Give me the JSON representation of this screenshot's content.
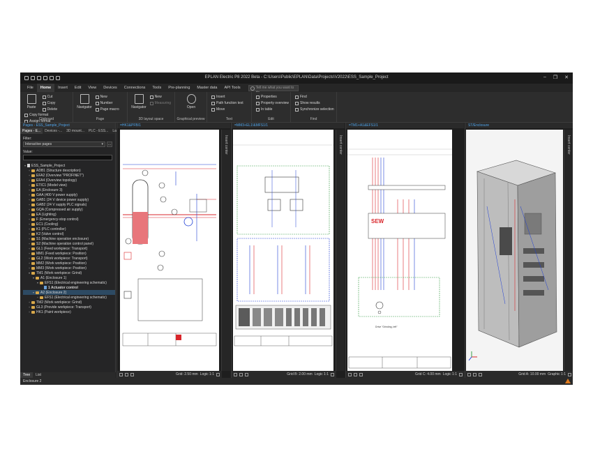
{
  "window": {
    "title": "EPLAN Electric P8 2022 Beta - C:\\Users\\Public\\EPLAN\\Data\\Projects\\V2022\\ESS_Sample_Project"
  },
  "menu": {
    "items": [
      "File",
      "Home",
      "Insert",
      "Edit",
      "View",
      "Devices",
      "Connections",
      "Tools",
      "Pre-planning",
      "Master data",
      "API Tools"
    ],
    "active": "Home",
    "help_placeholder": "Tell me what you want to do"
  },
  "ribbon": {
    "clipboard": {
      "label": "Clipboard",
      "paste": "Paste",
      "cut": "Cut",
      "copy": "Copy",
      "delete": "Delete",
      "copy_format": "Copy format",
      "assign_format": "Assign format"
    },
    "page": {
      "label": "Page",
      "navigator": "Navigator",
      "new": "New",
      "number": "Number",
      "page_macro": "Page macro"
    },
    "layout3d": {
      "label": "3D layout space",
      "navigator": "Navigator",
      "new": "New",
      "measuring": "Measuring"
    },
    "preview": {
      "label": "Graphical preview",
      "open": "Open"
    },
    "text": {
      "label": "Text",
      "insert": "Insert",
      "path_function_text": "Path function text",
      "move": "Move"
    },
    "edit": {
      "label": "Edit",
      "properties": "Properties",
      "property_overview": "Property overview",
      "in_table": "In table"
    },
    "find": {
      "label": "Find",
      "find": "Find",
      "show_results": "Show results",
      "sync_selection": "Synchronize selection"
    }
  },
  "sidebar": {
    "header": "Pages - ESS_Sample_Project",
    "tabs": [
      "Pages - E...",
      "Devices -...",
      "3D mount...",
      "PLC - ESS...",
      "Layout s..."
    ],
    "filter_label": "Filter:",
    "filter_value": "Interactive pages",
    "value_label": "Value:",
    "tree": [
      {
        "label": "ESS_Sample_Project",
        "level": 0,
        "kind": "root",
        "exp": "▾"
      },
      {
        "label": "ADB1 (Structure description)",
        "level": 1,
        "kind": "folder",
        "exp": "+"
      },
      {
        "label": "EFA2 (Overview \"PROFINET\")",
        "level": 1,
        "kind": "folder",
        "exp": "+"
      },
      {
        "label": "EFA4 (Overview topology)",
        "level": 1,
        "kind": "folder",
        "exp": "+"
      },
      {
        "label": "ETIC1 (Model view)",
        "level": 1,
        "kind": "folder",
        "exp": "+"
      },
      {
        "label": "EA (Enclosure 3)",
        "level": 1,
        "kind": "folder",
        "exp": "+"
      },
      {
        "label": "GAA (400 V power supply)",
        "level": 1,
        "kind": "folder",
        "exp": "+"
      },
      {
        "label": "GAB1 (24 V device power supply)",
        "level": 1,
        "kind": "folder",
        "exp": "+"
      },
      {
        "label": "GAB2 (24 V supply PLC signals)",
        "level": 1,
        "kind": "folder",
        "exp": "+"
      },
      {
        "label": "GQA (Compressed air supply)",
        "level": 1,
        "kind": "folder",
        "exp": "+"
      },
      {
        "label": "EA (Lighting)",
        "level": 1,
        "kind": "folder",
        "exp": "+"
      },
      {
        "label": "F (Emergency-stop control)",
        "level": 1,
        "kind": "folder",
        "exp": "+"
      },
      {
        "label": "EC1 (Cooling)",
        "level": 1,
        "kind": "folder",
        "exp": "+"
      },
      {
        "label": "K1 (PLC controller)",
        "level": 1,
        "kind": "folder",
        "exp": "+"
      },
      {
        "label": "K2 (Valve control)",
        "level": 1,
        "kind": "folder",
        "exp": "+"
      },
      {
        "label": "S1 (Machine operation enclosure)",
        "level": 1,
        "kind": "folder",
        "exp": "+"
      },
      {
        "label": "S2 (Machine operation control panel)",
        "level": 1,
        "kind": "folder",
        "exp": "+"
      },
      {
        "label": "GL1 (Feed workpiece: Transport)",
        "level": 1,
        "kind": "folder",
        "exp": "+"
      },
      {
        "label": "MM1 (Feed workpiece: Position)",
        "level": 1,
        "kind": "folder",
        "exp": "+"
      },
      {
        "label": "GL2 (Work workpiece: Transport)",
        "level": 1,
        "kind": "folder",
        "exp": "+"
      },
      {
        "label": "MM2 (Work workpiece: Position)",
        "level": 1,
        "kind": "folder",
        "exp": "+"
      },
      {
        "label": "MM3 (Work workpiece: Position)",
        "level": 1,
        "kind": "folder",
        "exp": "+"
      },
      {
        "label": "TM1 (Work workpiece: Grind)",
        "level": 1,
        "kind": "folder",
        "exp": "▾"
      },
      {
        "label": "A1 (Enclosure 1)",
        "level": 2,
        "kind": "folder",
        "exp": "▾"
      },
      {
        "label": "EFS1 (Electrical engineering schematic)",
        "level": 3,
        "kind": "folder",
        "exp": "▾"
      },
      {
        "label": "1 Actuator control",
        "level": 4,
        "kind": "page",
        "exp": ""
      },
      {
        "label": "A2 (Enclosure 2)",
        "level": 2,
        "kind": "folder",
        "exp": "▾",
        "selected": true
      },
      {
        "label": "EFS1 (Electrical engineering schematic)",
        "level": 3,
        "kind": "folder",
        "exp": "+"
      },
      {
        "label": "TM2 (Work workpiece: Grind)",
        "level": 1,
        "kind": "folder",
        "exp": "+"
      },
      {
        "label": "GL3 (Provide workpiece: Transport)",
        "level": 1,
        "kind": "folder",
        "exp": "+"
      },
      {
        "label": "HK1 (Paint workpiece)",
        "level": 1,
        "kind": "folder",
        "exp": "+"
      }
    ],
    "bottom_tabs": [
      "Tree",
      "List"
    ]
  },
  "panes": [
    {
      "tab": "=HK1&PFB/1",
      "side": "Insert center",
      "grid": "Grid: 2.50 mm",
      "logic": "Logic 1:1"
    },
    {
      "tab": "=MM3+EL1!&MFS1/1",
      "side": "Insert center",
      "grid": "Grid B: 2.00 mm",
      "logic": "Logic 1:1"
    },
    {
      "tab": "=TM1+A1&EFS1/1",
      "side": "Insert center",
      "grid": "Grid C: 4.00 mm",
      "logic": "Logic 1:1"
    },
    {
      "tab": "ST/Enclosure",
      "side": "Insert center",
      "grid": "Grid A: 10.00 mm",
      "logic": "Graphic 1:1"
    }
  ],
  "schematic_labels": {
    "sew": "SEW",
    "motor_caption": "Drive \"Grinding, left\""
  },
  "status": {
    "text": "Enclosure 2"
  },
  "colors": {
    "accent": "#4fa3e8",
    "warning": "#e07b1f",
    "tank_fill": "#e8767b",
    "wire_red": "#d9262b",
    "wire_blue": "#1f3fd6"
  }
}
